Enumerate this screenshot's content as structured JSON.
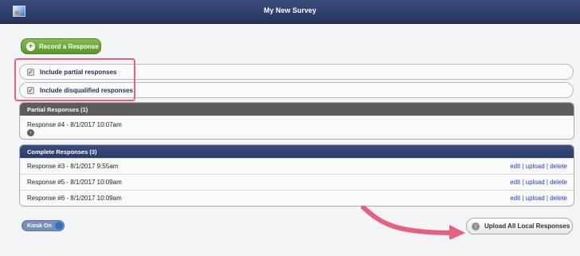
{
  "window": {
    "title": "My New Survey"
  },
  "toolbar": {
    "record_label": "Record a Response",
    "record_icon": "+"
  },
  "options": [
    {
      "label": "Include partial responses",
      "checked": true
    },
    {
      "label": "Include disqualified responses",
      "checked": true
    }
  ],
  "partial": {
    "header": "Partial Responses (1)",
    "responses": [
      {
        "label": "Response #4 - 8/1/2017 10:07am"
      }
    ]
  },
  "complete": {
    "header": "Complete Responses (3)",
    "responses": [
      {
        "label": "Response #3 - 8/1/2017 9:55am",
        "edit": "edit",
        "upload": "upload",
        "delete": "delete"
      },
      {
        "label": "Response #5 - 8/1/2017 10:09am",
        "edit": "edit",
        "upload": "upload",
        "delete": "delete"
      },
      {
        "label": "Response #6 - 8/1/2017 10:09am",
        "edit": "edit",
        "upload": "upload",
        "delete": "delete"
      }
    ]
  },
  "kiosk": {
    "label": "Kiosk On",
    "on": true
  },
  "upload_all": {
    "label": "Upload All Local Responses"
  },
  "colors": {
    "header": "#2b3c68",
    "accent_green": "#5b962b",
    "highlight": "#e8607f",
    "link": "#1c3ec8"
  }
}
